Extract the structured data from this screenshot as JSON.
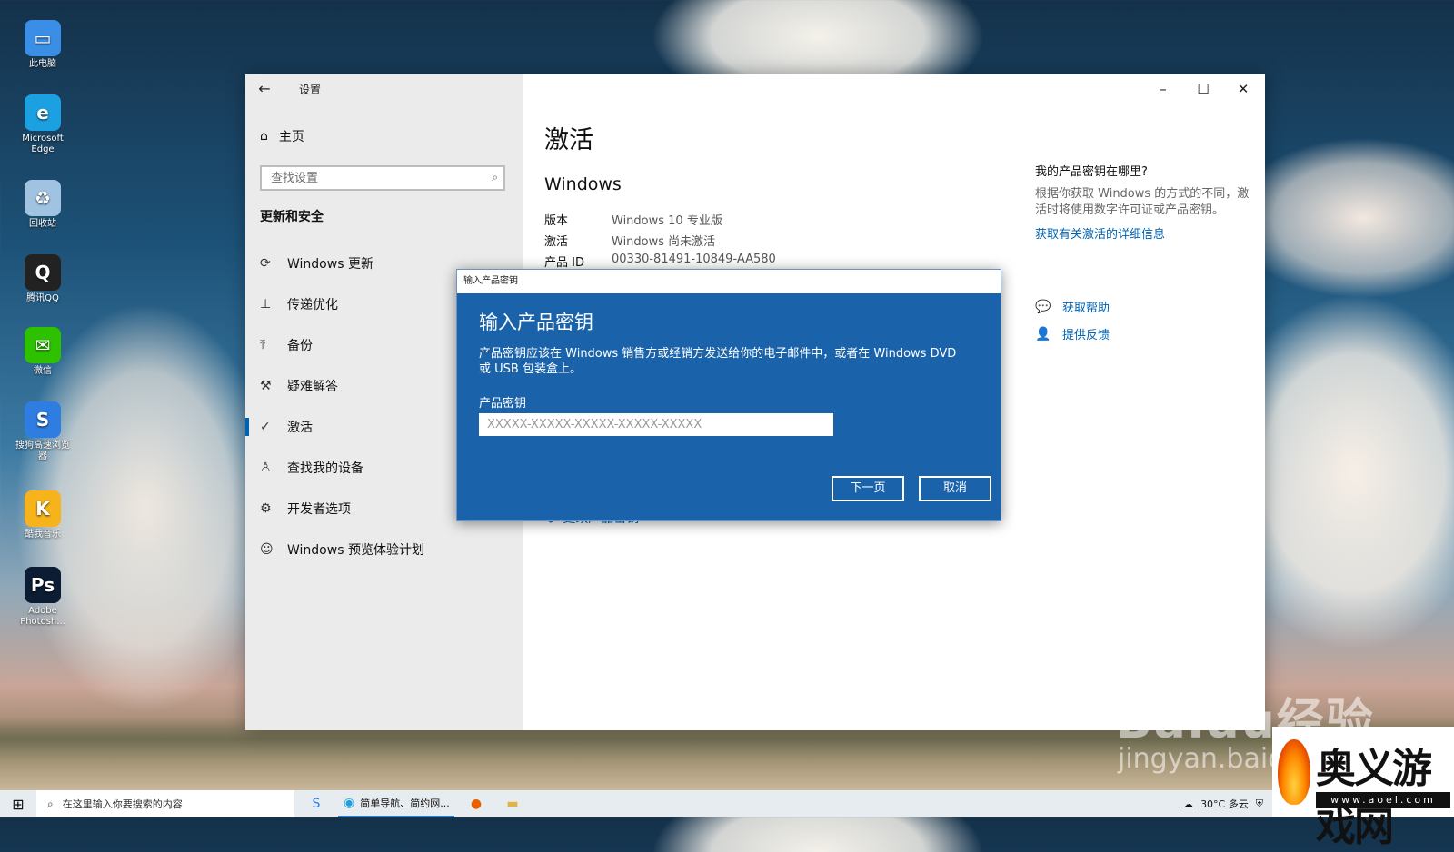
{
  "desktop": {
    "icons": [
      {
        "label": "此电脑",
        "icon": "computer-icon",
        "color": "#3a8ee6"
      },
      {
        "label": "Microsoft Edge",
        "icon": "edge-icon",
        "color": "#1ba1e2"
      },
      {
        "label": "回收站",
        "icon": "recycle-bin-icon",
        "color": "#9fc3e0"
      },
      {
        "label": "腾讯QQ",
        "icon": "qq-penguin-icon",
        "color": "#222222"
      },
      {
        "label": "微信",
        "icon": "wechat-icon",
        "color": "#2dc100"
      },
      {
        "label": "搜狗高速浏览器",
        "icon": "sogou-browser-icon",
        "color": "#2f7de1"
      },
      {
        "label": "酷我音乐",
        "icon": "kuwo-music-icon",
        "color": "#f6b31b"
      },
      {
        "label": "Adobe Photosh...",
        "icon": "photoshop-icon",
        "color": "#0b1c33"
      }
    ]
  },
  "window": {
    "title": "设置",
    "controls": {
      "minimize": "–",
      "maximize": "☐",
      "close": "✕"
    },
    "sidebar": {
      "home_label": "主页",
      "search_placeholder": "查找设置",
      "section_title": "更新和安全",
      "items": [
        {
          "label": "Windows 更新",
          "icon": "refresh-icon",
          "glyph": "⟳"
        },
        {
          "label": "传递优化",
          "icon": "delivery-optimization-icon",
          "glyph": "⊥"
        },
        {
          "label": "备份",
          "icon": "backup-upload-icon",
          "glyph": "⤒"
        },
        {
          "label": "疑难解答",
          "icon": "wrench-icon",
          "glyph": "⚒"
        },
        {
          "label": "激活",
          "icon": "check-circle-icon",
          "glyph": "✓",
          "active": true
        },
        {
          "label": "查找我的设备",
          "icon": "find-device-person-icon",
          "glyph": "♙"
        },
        {
          "label": "开发者选项",
          "icon": "developer-tools-icon",
          "glyph": "⚙"
        },
        {
          "label": "Windows 预览体验计划",
          "icon": "insider-cat-icon",
          "glyph": "☺"
        }
      ]
    },
    "content": {
      "page_title": "激活",
      "subheading": "Windows",
      "details": [
        {
          "key": "版本",
          "value": "Windows 10 专业版"
        },
        {
          "key": "激活",
          "value": "Windows 尚未激活"
        },
        {
          "key": "产品 ID",
          "value": "00330-81491-10849-AA580"
        }
      ],
      "change_key_label": "更改产品密钥"
    },
    "right_panel": {
      "title": "我的产品密钥在哪里?",
      "text": "根据你获取 Windows 的方式的不同，激活时将使用数字许可证或产品密钥。",
      "link": "获取有关激活的详细信息",
      "help_label": "获取帮助",
      "feedback_label": "提供反馈"
    }
  },
  "dialog": {
    "titlebar": "输入产品密钥",
    "heading": "输入产品密钥",
    "description": "产品密钥应该在 Windows 销售方或经销方发送给你的电子邮件中，或者在 Windows DVD 或 USB 包装盒上。",
    "field_label": "产品密钥",
    "field_placeholder": "XXXXX-XXXXX-XXXXX-XXXXX-XXXXX",
    "next_label": "下一页",
    "cancel_label": "取消",
    "background_color": "#1a63ab"
  },
  "taskbar": {
    "search_placeholder": "在这里输入你要搜索的内容",
    "active_app_label": "简单导航、简约网...",
    "weather": "30°C 多云"
  },
  "watermarks": {
    "baidu": "Baidu经验",
    "jingyan": "jingyan.baidu",
    "logo_text": "奥义游戏网",
    "logo_url": "www.aoel.com"
  }
}
